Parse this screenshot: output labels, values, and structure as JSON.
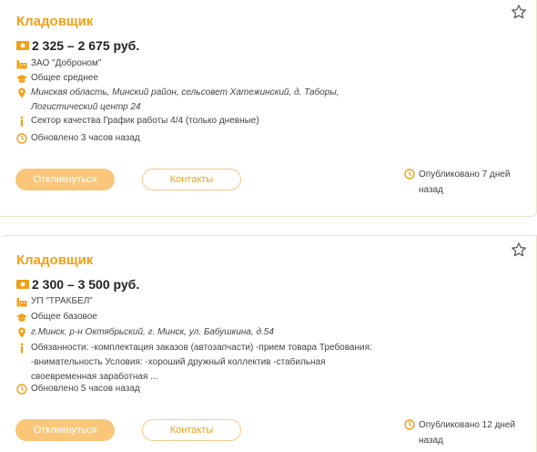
{
  "colors": {
    "accent": "#f0a019",
    "apply_button_bg": "#fac77a",
    "icon": "#f0a019"
  },
  "vacancies": [
    {
      "title": "Кладовщик",
      "salary": "2 325 – 2 675 руб.",
      "company": "ЗАО \"Доброном\"",
      "education": "Общее среднее",
      "address": "Минская область, Минский район, сельсовет Хатежинский, д. Таборы, Логистический центр 24",
      "details": "Сектор качества График работы 4/4 (только дневные)",
      "updated": "Обновлено 3 часов назад",
      "apply_label": "Откликнуться",
      "contacts_label": "Контакты",
      "published": "Опубликовано 7 дней назад"
    },
    {
      "title": "Кладовщик",
      "salary": "2 300 – 3 500 руб.",
      "company": "УП \"ТРАКБЕЛ\"",
      "education": "Общее базовое",
      "address": "г.Минск, р-н Октябрьский, г. Минск, ул. Бабушкина, д.54",
      "details": "Обязанности: -комплектация заказов (автозапчасти) -прием товара Требования: -внимательность Условия: -хороший дружный коллектив -стабильная своевременная заработная ...",
      "updated": "Обновлено 5 часов назад",
      "apply_label": "Откликнуться",
      "contacts_label": "Контакты",
      "published": "Опубликовано 12 дней назад"
    }
  ]
}
